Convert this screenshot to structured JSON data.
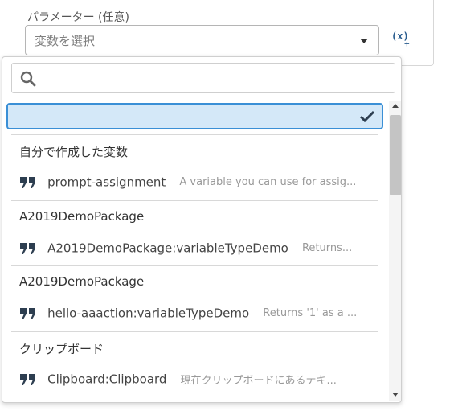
{
  "parameter": {
    "label": "パラメーター (任意)",
    "select_placeholder": "変数を選択",
    "insert_variable": "(x)",
    "insert_plus": "+"
  },
  "dropdown": {
    "search_placeholder": "",
    "groups": [
      {
        "title": "自分で作成した変数",
        "item_name": "prompt-assignment",
        "item_desc": "A variable you can use for assig..."
      },
      {
        "title": "A2019DemoPackage",
        "item_name": "A2019DemoPackage:variableTypeDemo",
        "item_desc": "Returns..."
      },
      {
        "title": "A2019DemoPackage",
        "item_name": "hello-aaaction:variableTypeDemo",
        "item_desc": "Returns '1' as a ..."
      },
      {
        "title": "クリップボード",
        "item_name": "Clipboard:Clipboard",
        "item_desc": "現在クリップボードにあるテキ..."
      }
    ]
  },
  "icons": {
    "search": "search-icon",
    "check": "check-icon",
    "quote": "quote-icon",
    "caret": "chevron-down-icon"
  },
  "colors": {
    "accent": "#3a8fd6",
    "selected_bg": "#d4e8f8",
    "icon_dark": "#2d3e50"
  }
}
